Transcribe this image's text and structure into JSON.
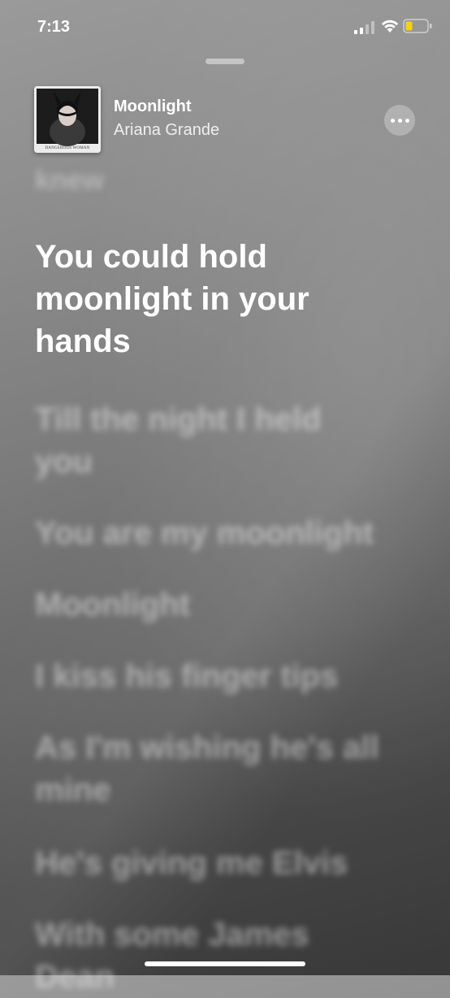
{
  "status_bar": {
    "time": "7:13",
    "battery_color": "#f2d21a"
  },
  "now_playing": {
    "title": "Moonlight",
    "artist": "Ariana Grande",
    "album_caption": "DANGEROUS WOMAN",
    "more_icon": "ellipsis-icon"
  },
  "lyrics": {
    "previous": "knew",
    "current": "You could hold moonlight in your hands",
    "upcoming": [
      "Till the night I held you",
      "You are my moonlight",
      "Moonlight",
      "I kiss his finger tips",
      "As I'm wishing he's all mine",
      "He's giving me Elvis",
      "With some James Dean"
    ]
  }
}
